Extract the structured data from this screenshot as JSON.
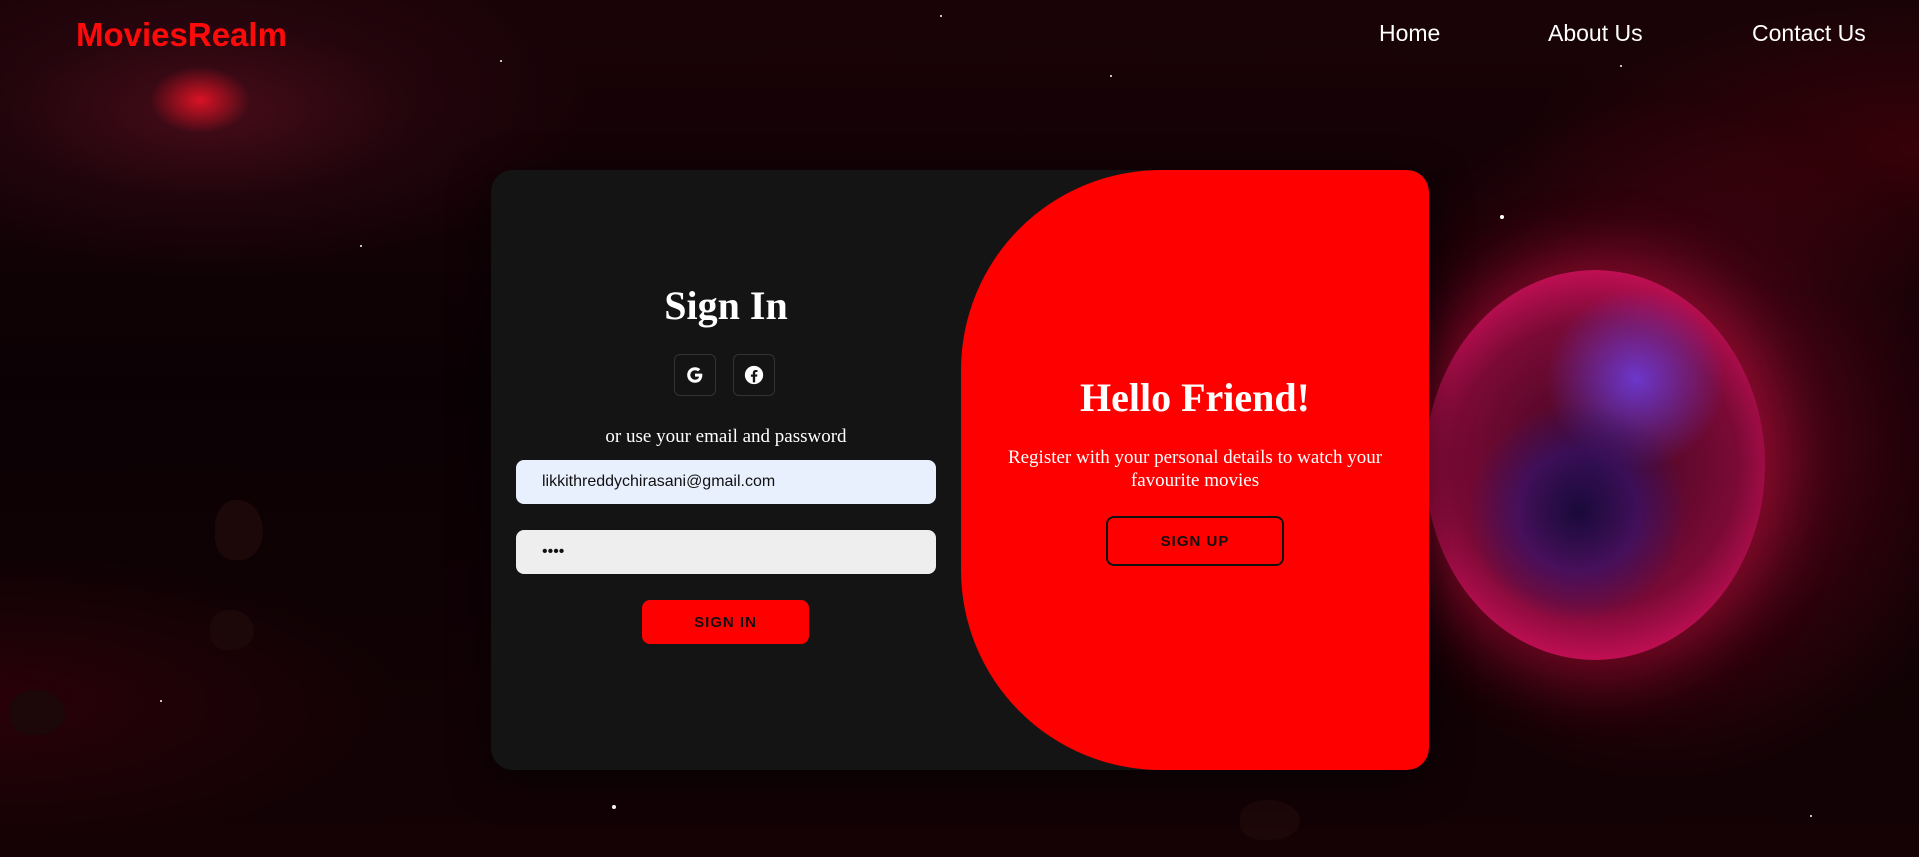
{
  "brand": {
    "name": "MoviesRealm",
    "color": "#ff0a0a"
  },
  "nav": {
    "links": [
      {
        "label": "Home"
      },
      {
        "label": "About Us"
      },
      {
        "label": "Contact Us"
      }
    ]
  },
  "signin": {
    "title": "Sign In",
    "social_icons": [
      "google-icon",
      "facebook-icon"
    ],
    "subtitle": "or use your email and password",
    "email_value": "likkithreddychirasani@gmail.com",
    "password_value": "••••",
    "button_label": "SIGN IN"
  },
  "overlay": {
    "title": "Hello Friend!",
    "text": "Register with your personal details to watch your favourite movies",
    "button_label": "SIGN UP"
  },
  "colors": {
    "accent": "#ff0000",
    "card_bg": "#141414",
    "email_field_bg": "#e8f0fe",
    "password_field_bg": "#eeeeee"
  }
}
